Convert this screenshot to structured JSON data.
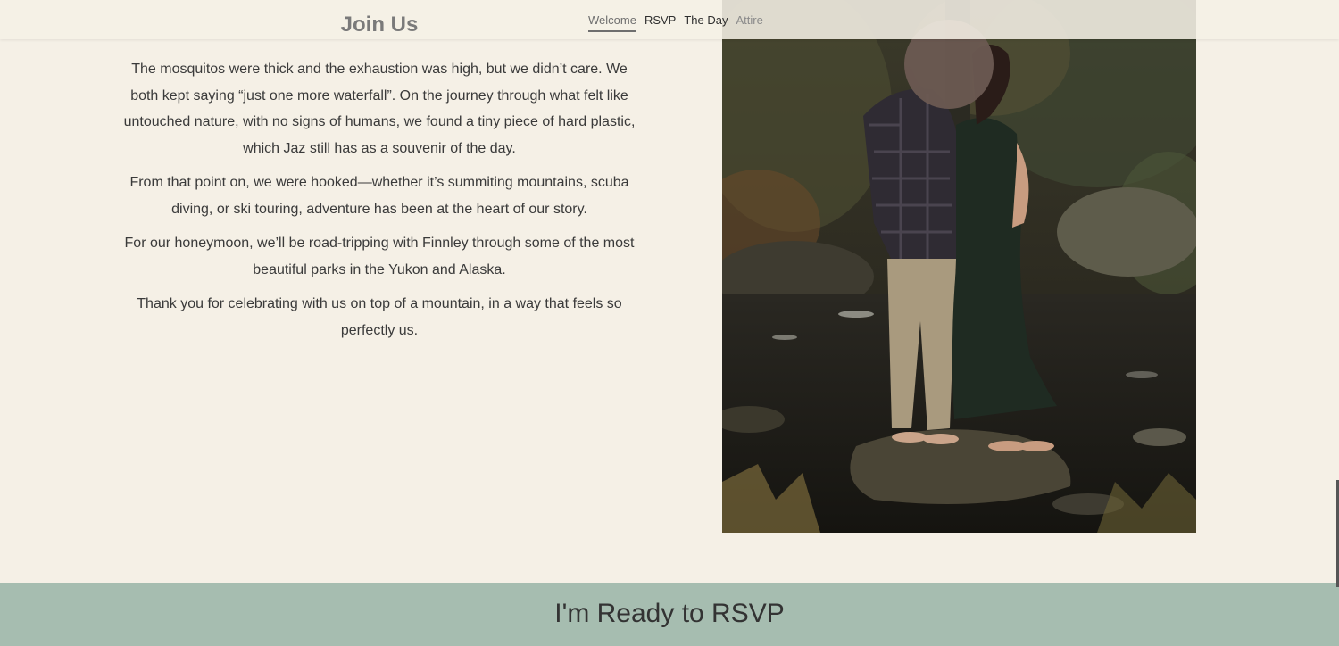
{
  "header": {
    "title": "Join Us",
    "nav": [
      {
        "label": "Welcome"
      },
      {
        "label": "RSVP"
      },
      {
        "label": "The Day"
      },
      {
        "label": "Attire"
      }
    ]
  },
  "story": {
    "paragraphs": [
      "The mosquitos were thick and the exhaustion was high, but we didn’t care. We both kept saying “just one more waterfall”. On the journey through what felt like untouched nature, with no signs of humans, we found a tiny piece of hard plastic, which Jaz still has as a souvenir of the day.",
      "From that point on, we were hooked—whether it’s summiting mountains, scuba diving, or ski touring, adventure has been at the heart of our story.",
      "For our honeymoon, we’ll be road-tripping with Finnley through some of the most beautiful parks in the Yukon and Alaska.",
      "Thank you for celebrating with us on top of a mountain, in a way that feels so perfectly us."
    ]
  },
  "cta": {
    "label": "I'm Ready to RSVP"
  },
  "colors": {
    "background": "#f5f0e6",
    "cta_background": "#a6bdb0",
    "text": "#3a3a3a"
  }
}
